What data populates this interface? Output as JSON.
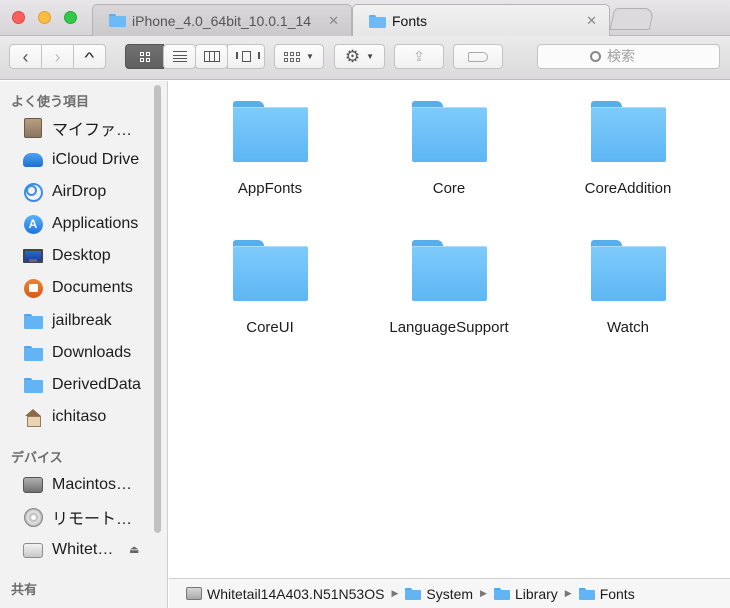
{
  "window": {
    "tabs": [
      {
        "label": "iPhone_4.0_64bit_10.0.1_14"
      },
      {
        "label": "Fonts"
      }
    ]
  },
  "toolbar": {
    "search_placeholder": "検索"
  },
  "sidebar": {
    "favorites_header": "よく使う項目",
    "favorites": [
      {
        "label": "マイファ…"
      },
      {
        "label": "iCloud Drive"
      },
      {
        "label": "AirDrop"
      },
      {
        "label": "Applications"
      },
      {
        "label": "Desktop"
      },
      {
        "label": "Documents"
      },
      {
        "label": "jailbreak"
      },
      {
        "label": "Downloads"
      },
      {
        "label": "DerivedData"
      },
      {
        "label": "ichitaso"
      }
    ],
    "devices_header": "デバイス",
    "devices": [
      {
        "label": "Macintos…"
      },
      {
        "label": "リモート…"
      },
      {
        "label": "Whitet…"
      }
    ],
    "shared_header": "共有"
  },
  "content": {
    "folders": [
      {
        "name": "AppFonts"
      },
      {
        "name": "Core"
      },
      {
        "name": "CoreAddition"
      },
      {
        "name": "CoreUI"
      },
      {
        "name": "LanguageSupport"
      },
      {
        "name": "Watch"
      }
    ]
  },
  "pathbar": {
    "segments": [
      {
        "label": "Whitetail14A403.N51N53OS"
      },
      {
        "label": "System"
      },
      {
        "label": "Library"
      },
      {
        "label": "Fonts"
      }
    ]
  }
}
